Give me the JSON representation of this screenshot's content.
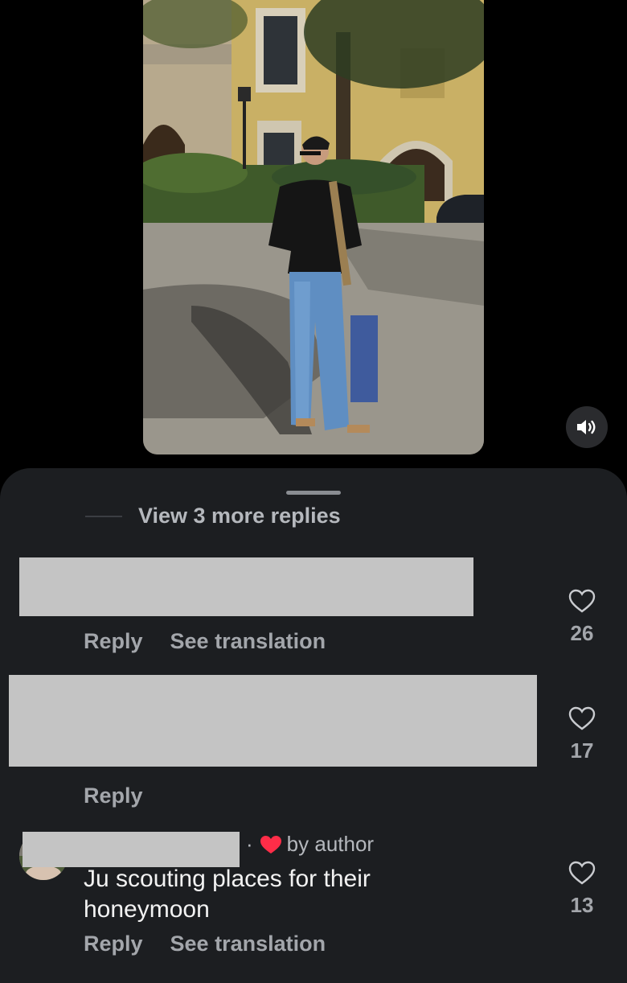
{
  "media": {
    "alt": ""
  },
  "sheet": {
    "view_more": "View 3 more replies",
    "comments": [
      {
        "reply": "Reply",
        "translate": "See translation",
        "likes": "26"
      },
      {
        "reply": "Reply",
        "likes": "17"
      },
      {
        "byline_dot": "·",
        "byline_text": "by author",
        "text": "Ju scouting places for their honeymoon",
        "reply": "Reply",
        "translate": "See translation",
        "likes": "13"
      }
    ]
  },
  "colors": {
    "sheet_bg": "#1c1e21",
    "heart_red": "#ff2d48",
    "muted_text": "#a3a6ab"
  },
  "icons": {
    "sound": "speaker-icon",
    "like": "heart-outline-icon",
    "author": "heart-filled-icon"
  }
}
